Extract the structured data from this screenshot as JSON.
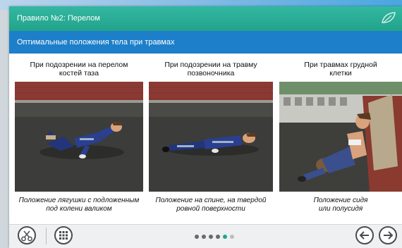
{
  "window": {
    "title": "Правило №2: Перелом",
    "subtitle": "Оптимальные положения тела при травмах"
  },
  "panels": [
    {
      "heading_line1": "При подозрении на перелом",
      "heading_line2": "костей таза",
      "caption_line1": "Положение лягушки с подложенным",
      "caption_line2": "под колени валиком"
    },
    {
      "heading_line1": "При подозрении на травму",
      "heading_line2": "позвоночника",
      "caption_line1": "Положение на спине, на твердой",
      "caption_line2": "ровной поверхности"
    },
    {
      "heading_line1": "При травмах грудной",
      "heading_line2": "клетки",
      "caption_line1": "Положение сидя",
      "caption_line2": "или полусидя"
    }
  ],
  "footer": {
    "pagination_total": 6,
    "pagination_current": 5,
    "icons": [
      "scissors-icon",
      "grid-menu-icon",
      "arrow-left-icon",
      "arrow-right-icon"
    ]
  },
  "colors": {
    "titlebar": "#22a28b",
    "subbar": "#1d7fc9",
    "active_dot": "#20a58c"
  }
}
